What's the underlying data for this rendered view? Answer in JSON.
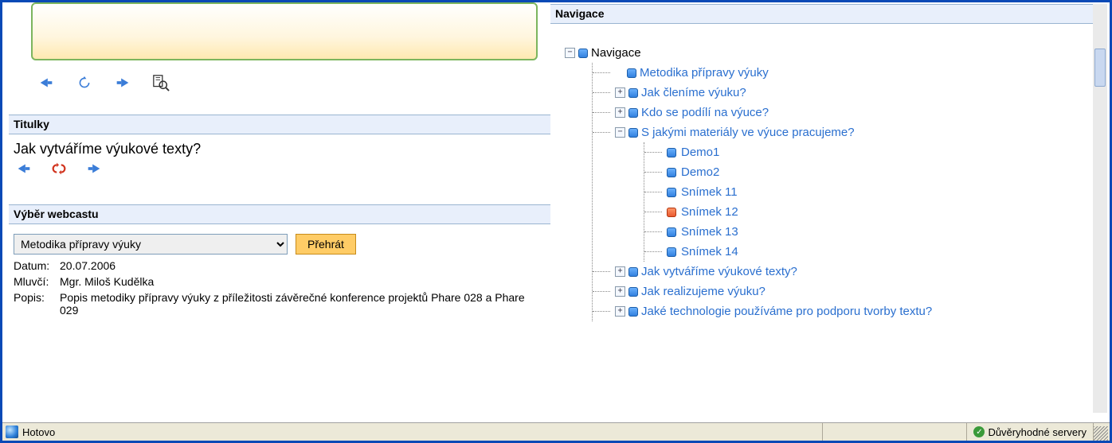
{
  "left": {
    "sections": {
      "subtitles_heading": "Titulky",
      "subtitle_text": "Jak vytváříme výukové texty?",
      "webcast_heading": "Výběr webcastu"
    },
    "webcast": {
      "selected": "Metodika přípravy výuky",
      "play_label": "Přehrát",
      "date_label": "Datum:",
      "date_value": "20.07.2006",
      "speaker_label": "Mluvčí:",
      "speaker_value": "Mgr. Miloš Kudělka",
      "desc_label": "Popis:",
      "desc_value": "Popis metodiky přípravy výuky z příležitosti závěrečné konference projektů Phare 028 a Phare 029"
    }
  },
  "nav": {
    "heading": "Navigace",
    "root": "Navigace",
    "items": [
      {
        "label": "Metodika přípravy výuky",
        "expand": "none",
        "children": []
      },
      {
        "label": "Jak členíme výuku?",
        "expand": "plus",
        "children": []
      },
      {
        "label": "Kdo se podílí na výuce?",
        "expand": "plus",
        "children": []
      },
      {
        "label": "S jakými materiály ve výuce pracujeme?",
        "expand": "minus",
        "children": [
          {
            "label": "Demo1",
            "active": false
          },
          {
            "label": "Demo2",
            "active": false
          },
          {
            "label": "Snímek 11",
            "active": false
          },
          {
            "label": "Snímek 12",
            "active": true
          },
          {
            "label": "Snímek 13",
            "active": false
          },
          {
            "label": "Snímek 14",
            "active": false
          }
        ]
      },
      {
        "label": "Jak vytváříme výukové texty?",
        "expand": "plus",
        "children": []
      },
      {
        "label": "Jak realizujeme výuku?",
        "expand": "plus",
        "children": []
      },
      {
        "label": "Jaké technologie používáme pro podporu tvorby textu?",
        "expand": "plus",
        "children": []
      }
    ]
  },
  "status": {
    "text": "Hotovo",
    "trust": "Důvěryhodné servery"
  }
}
